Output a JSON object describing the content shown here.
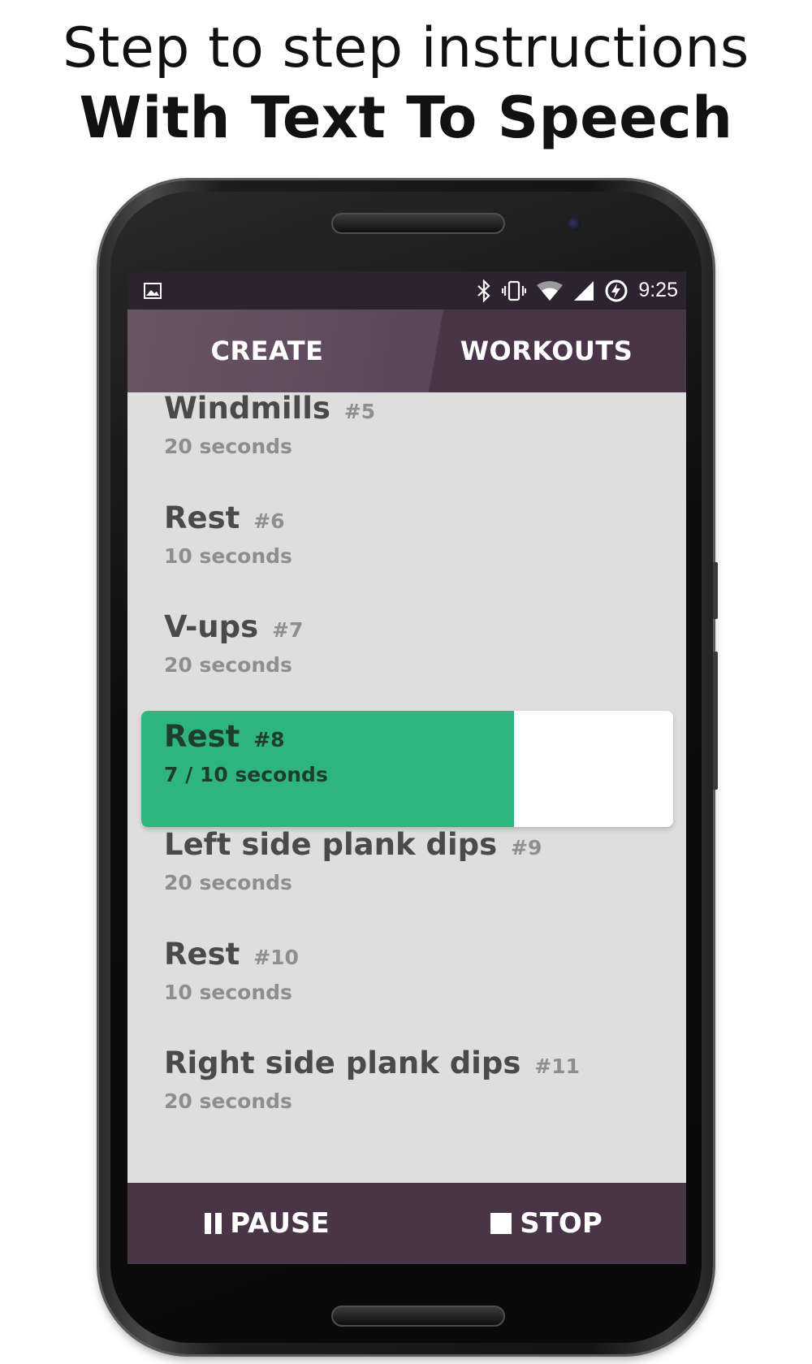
{
  "headline": {
    "line1": "Step to step instructions",
    "line2": "With Text To Speech"
  },
  "statusbar": {
    "left_icon": "image-icon",
    "icons": [
      "bluetooth-icon",
      "vibrate-icon",
      "wifi-icon",
      "signal-icon",
      "battery-charging-icon"
    ],
    "time": "9:25"
  },
  "tabs": [
    {
      "label": "CREATE"
    },
    {
      "label": "WORKOUTS"
    }
  ],
  "items": [
    {
      "title": "Windmills",
      "num": "#5",
      "sub": "20 seconds"
    },
    {
      "title": "Rest",
      "num": "#6",
      "sub": "10 seconds"
    },
    {
      "title": "V-ups",
      "num": "#7",
      "sub": "20 seconds"
    },
    {
      "title": "Rest",
      "num": "#8",
      "sub": "7 / 10 seconds",
      "progress": 0.7
    },
    {
      "title": "Left side plank dips",
      "num": "#9",
      "sub": "20 seconds"
    },
    {
      "title": "Rest",
      "num": "#10",
      "sub": "10 seconds"
    },
    {
      "title": "Right side plank dips",
      "num": "#11",
      "sub": "20 seconds"
    }
  ],
  "bottombar": {
    "pause_label": "PAUSE",
    "stop_label": "STOP"
  },
  "colors": {
    "status": "#2d2230",
    "tabs": "#4a3548",
    "progress": "#2db57d",
    "list_bg": "#dedede"
  }
}
